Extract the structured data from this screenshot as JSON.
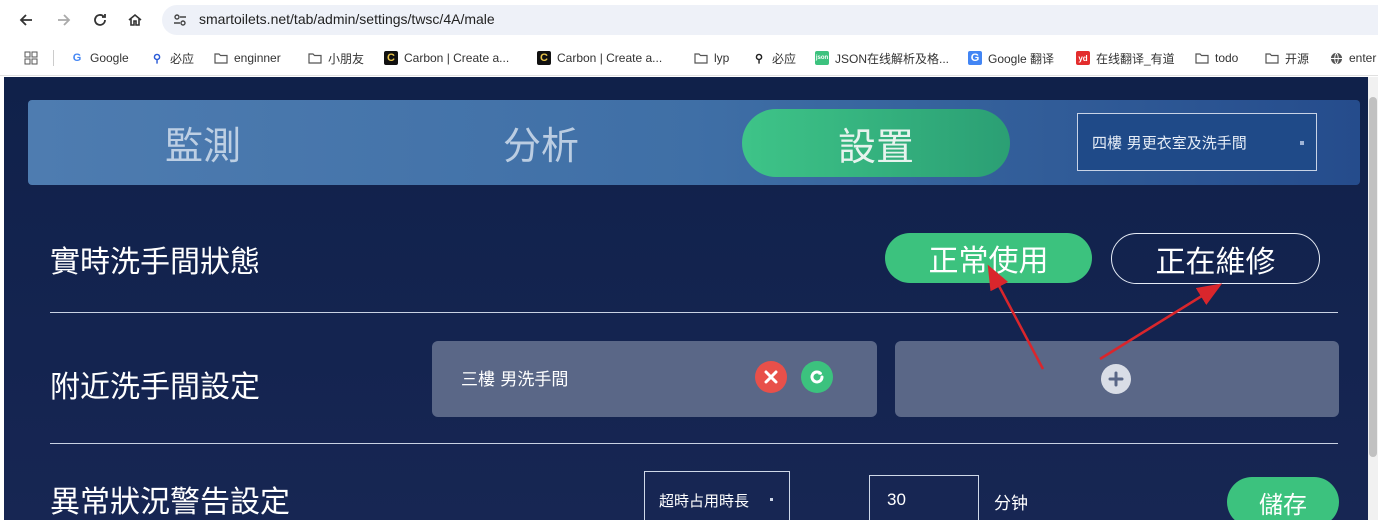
{
  "browser": {
    "url": "smartoilets.net/tab/admin/settings/twsc/4A/male",
    "bookmarks": [
      {
        "label": "",
        "icon": "apps-grid-icon"
      },
      {
        "label": "Google",
        "icon": "google-icon"
      },
      {
        "label": "必应",
        "icon": "search-icon"
      },
      {
        "label": "enginner",
        "icon": "folder-icon"
      },
      {
        "label": "小朋友",
        "icon": "folder-icon"
      },
      {
        "label": "Carbon | Create a...",
        "icon": "carbon-icon"
      },
      {
        "label": "Carbon | Create a...",
        "icon": "carbon-icon"
      },
      {
        "label": "lyp",
        "icon": "folder-icon"
      },
      {
        "label": "必应",
        "icon": "search-icon"
      },
      {
        "label": "JSON在线解析及格...",
        "icon": "json-icon"
      },
      {
        "label": "Google 翻译",
        "icon": "translate-icon"
      },
      {
        "label": "在线翻译_有道",
        "icon": "youdao-icon"
      },
      {
        "label": "todo",
        "icon": "folder-icon"
      },
      {
        "label": "开源",
        "icon": "folder-icon"
      },
      {
        "label": "enter",
        "icon": "globe-icon"
      }
    ]
  },
  "tabs": {
    "monitor": "監測",
    "analysis": "分析",
    "settings": "設置",
    "floor_select": "四樓 男更衣室及洗手間"
  },
  "realtime": {
    "title": "實時洗手間狀態",
    "normal_label": "正常使用",
    "repair_label": "正在維修"
  },
  "nearby": {
    "title": "附近洗手間設定",
    "card_label": "三樓 男洗手間"
  },
  "alert": {
    "title": "異常狀況警告設定",
    "select_value": "超時占用時長",
    "minutes_value": "30",
    "unit": "分钟",
    "save_label": "儲存"
  },
  "colors": {
    "accent_green": "#3cc27e",
    "page_bg": "#142450",
    "annotation_red": "#d9262c",
    "delete_red": "#e8504a",
    "refresh_green": "#3cc27e"
  }
}
